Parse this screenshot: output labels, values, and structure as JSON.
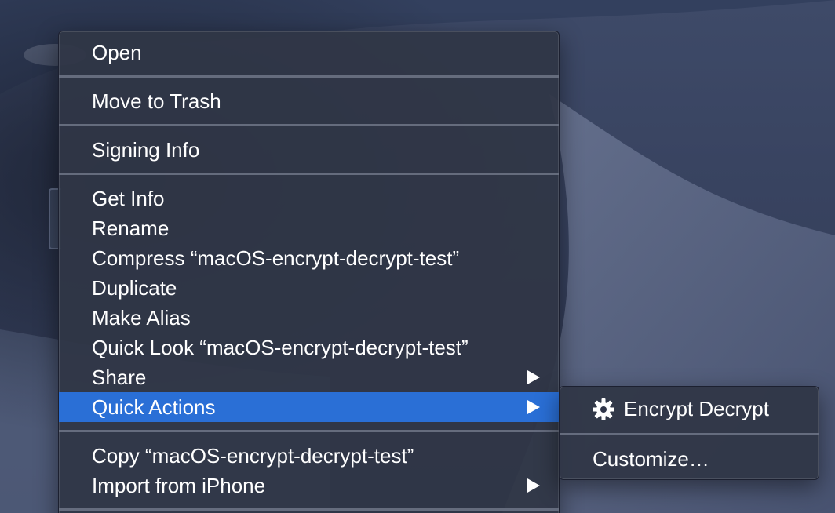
{
  "context_menu": {
    "items": [
      {
        "label": "Open"
      },
      {
        "label": "Move to Trash"
      },
      {
        "label": "Signing Info"
      },
      {
        "label": "Get Info"
      },
      {
        "label": "Rename"
      },
      {
        "label": "Compress “macOS-encrypt-decrypt-test”"
      },
      {
        "label": "Duplicate"
      },
      {
        "label": "Make Alias"
      },
      {
        "label": "Quick Look “macOS-encrypt-decrypt-test”"
      },
      {
        "label": "Share"
      },
      {
        "label": "Quick Actions"
      },
      {
        "label": "Copy “macOS-encrypt-decrypt-test”"
      },
      {
        "label": "Import from iPhone"
      }
    ],
    "highlight_color": "#2a6fd6"
  },
  "submenu": {
    "items": [
      {
        "label": "Encrypt Decrypt",
        "icon": "gear-icon"
      },
      {
        "label": "Customize…"
      }
    ]
  },
  "desktop": {
    "wallpaper": "Mojave night dunes",
    "colors": {
      "sky": "#2f3a58",
      "dune": "#5a6684"
    }
  }
}
